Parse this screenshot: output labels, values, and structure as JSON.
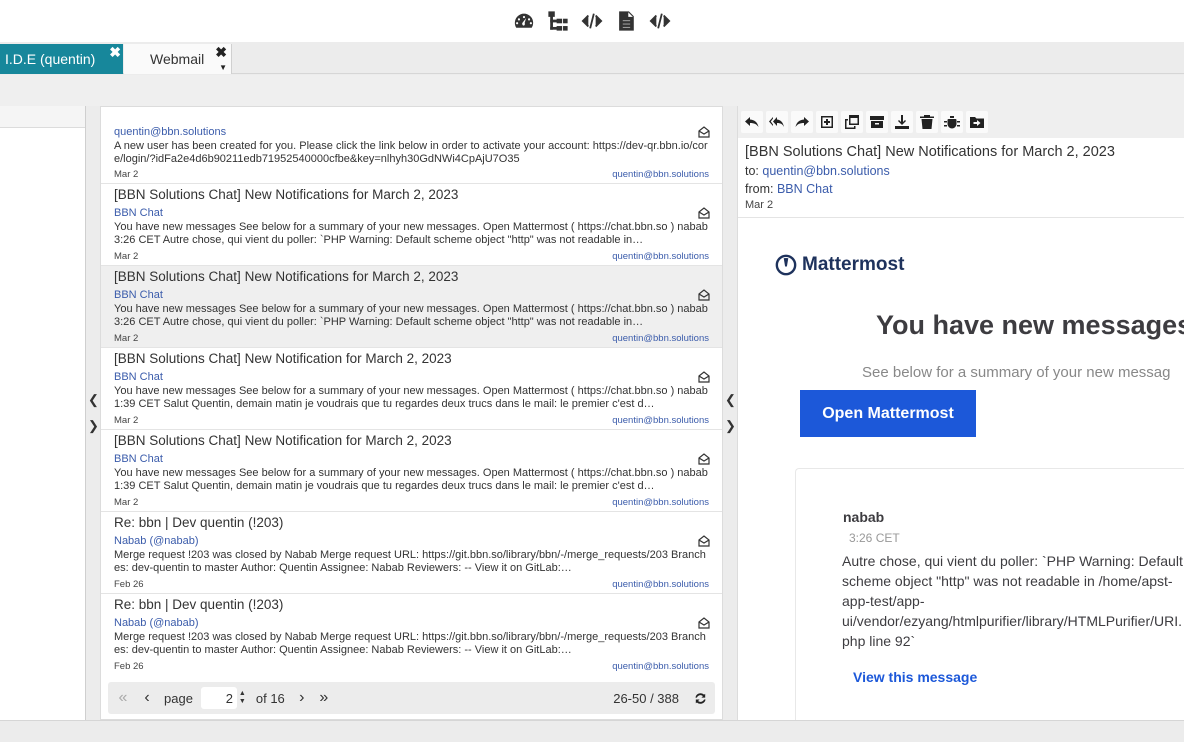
{
  "top_toolbar": {
    "icons": [
      "dashboard-icon",
      "tree-icon",
      "code-icon",
      "document-icon",
      "code-icon"
    ]
  },
  "tabs": [
    {
      "label": "I.D.E (quentin)",
      "active": true
    },
    {
      "label": "Webmail",
      "active": false
    }
  ],
  "mail_list": {
    "items": [
      {
        "subject": "",
        "from": "quentin@bbn.solutions",
        "body": "A new user has been created for you. Please click the link below in order to activate your account: https://dev-qr.bbn.io/core/login/?idFa2e4d6b90211edb71952540000cfbe&key=nlhyh30GdNWi4CpAjU7O35",
        "date": "Mar 2",
        "to": "quentin@bbn.solutions"
      },
      {
        "subject": "[BBN Solutions Chat] New Notifications for March 2, 2023",
        "from": "BBN Chat",
        "body": "You have new messages See below for a summary of your new messages. Open Mattermost ( https://chat.bbn.so ) nabab 3:26 CET Autre chose, qui vient du poller: `PHP Warning: Default scheme object \"http\" was not readable in…",
        "date": "Mar 2",
        "to": "quentin@bbn.solutions"
      },
      {
        "subject": "[BBN Solutions Chat] New Notifications for March 2, 2023",
        "from": "BBN Chat",
        "body": "You have new messages See below for a summary of your new messages. Open Mattermost ( https://chat.bbn.so ) nabab 3:26 CET Autre chose, qui vient du poller: `PHP Warning: Default scheme object \"http\" was not readable in…",
        "date": "Mar 2",
        "to": "quentin@bbn.solutions",
        "selected": true
      },
      {
        "subject": "[BBN Solutions Chat] New Notification for March 2, 2023",
        "from": "BBN Chat",
        "body": "You have new messages See below for a summary of your new messages. Open Mattermost ( https://chat.bbn.so ) nabab 1:39 CET Salut Quentin, demain matin je voudrais que tu regardes deux trucs dans le mail: le premier c'est d…",
        "date": "Mar 2",
        "to": "quentin@bbn.solutions"
      },
      {
        "subject": "[BBN Solutions Chat] New Notification for March 2, 2023",
        "from": "BBN Chat",
        "body": "You have new messages See below for a summary of your new messages. Open Mattermost ( https://chat.bbn.so ) nabab 1:39 CET Salut Quentin, demain matin je voudrais que tu regardes deux trucs dans le mail: le premier c'est d…",
        "date": "Mar 2",
        "to": "quentin@bbn.solutions"
      },
      {
        "subject": "Re: bbn | Dev quentin (!203)",
        "from": "Nabab (@nabab)",
        "body": "Merge request !203 was closed by Nabab Merge request URL: https://git.bbn.so/library/bbn/-/merge_requests/203 Branches: dev-quentin to master Author: Quentin Assignee: Nabab Reviewers: -- View it on GitLab:…",
        "date": "Feb 26",
        "to": "quentin@bbn.solutions"
      },
      {
        "subject": "Re: bbn | Dev quentin (!203)",
        "from": "Nabab (@nabab)",
        "body": "Merge request !203 was closed by Nabab Merge request URL: https://git.bbn.so/library/bbn/-/merge_requests/203 Branches: dev-quentin to master Author: Quentin Assignee: Nabab Reviewers: -- View it on GitLab:…",
        "date": "Feb 26",
        "to": "quentin@bbn.solutions"
      }
    ]
  },
  "pager": {
    "page_label": "page",
    "page_value": "2",
    "of_label": "of 16",
    "range": "26-50 / 388"
  },
  "reader": {
    "toolbar_icons": [
      "reply-icon",
      "reply-all-icon",
      "forward-icon",
      "open-new-icon",
      "open-window-icon",
      "archive-icon",
      "move-to-icon",
      "trash-icon",
      "spam-icon",
      "folder-move-icon"
    ],
    "subject": "[BBN Solutions Chat] New Notifications for March 2, 2023",
    "to_label": "to:",
    "to": "quentin@bbn.solutions",
    "from_label": "from:",
    "from": "BBN Chat",
    "date": "Mar 2",
    "body": {
      "logo_text": "Mattermost",
      "title": "You have new messages",
      "subtitle": "See below for a summary of your new messag",
      "button": "Open Mattermost",
      "user": "nabab",
      "time": "3:26 CET",
      "message": "Autre chose, qui vient du poller: `PHP Warning: Default scheme object \"http\" was not readable in /home/apst-app-test/app-ui/vendor/ezyang/htmlpurifier/library/HTMLPurifier/URI.php line 92`",
      "view_link": "View this message"
    }
  },
  "colors": {
    "tab_active": "#17879b",
    "link": "#3b5cab",
    "mattermost_blue": "#1c58d9"
  }
}
